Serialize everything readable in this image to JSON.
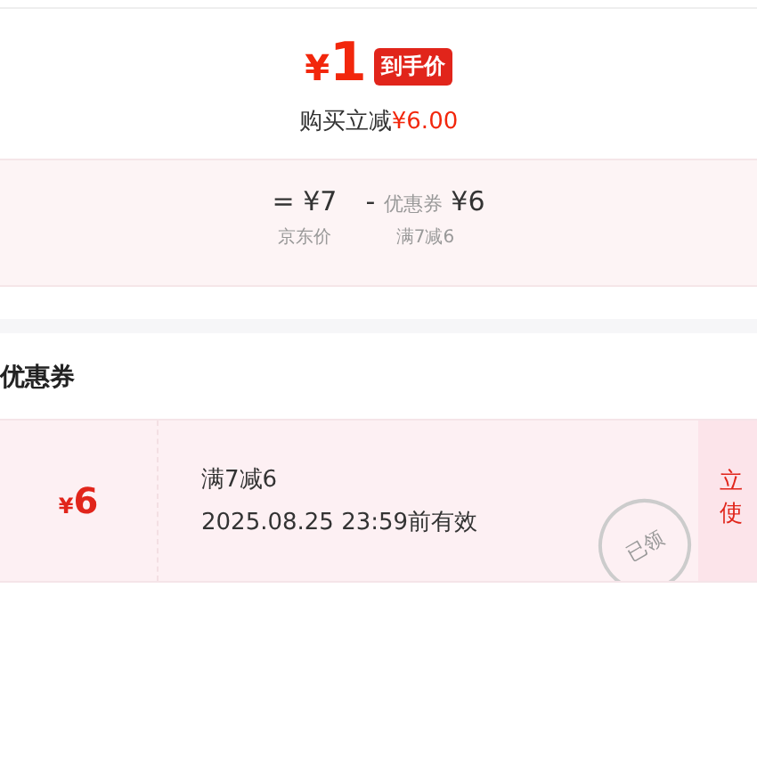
{
  "price": {
    "symbol": "¥",
    "amount": "1",
    "badge": "到手价",
    "reduce_label": "购买立减",
    "reduce_amount": "¥6.00"
  },
  "breakdown": [
    {
      "op": "=",
      "value": "¥7",
      "caption": "京东价"
    },
    {
      "op": "-",
      "label": "优惠券",
      "value": "¥6",
      "caption": "满7减6"
    }
  ],
  "coupons_title": "优惠券",
  "coupon": {
    "symbol": "¥",
    "amount": "6",
    "title": "满7减6",
    "validity": "2025.08.25 23:59前有效",
    "stamp": "已领",
    "claimed": true,
    "action_lines": [
      "立",
      "使"
    ]
  }
}
